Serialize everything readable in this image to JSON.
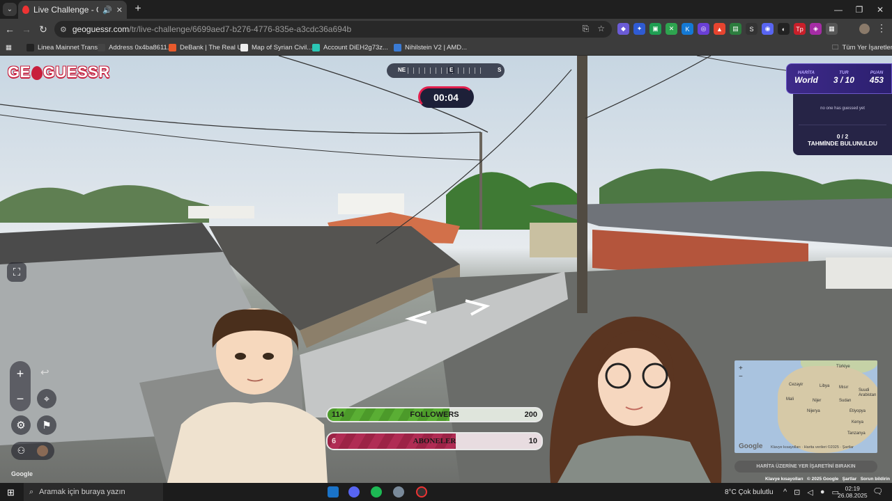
{
  "browser": {
    "tab_title": "Live Challenge - GeoGuessr",
    "url_host": "geoguessr.com",
    "url_path": "/tr/live-challenge/6699aed7-b276-4776-835e-a3cdc36a694b",
    "new_tab": "+",
    "bookmarks": [
      {
        "label": "Linea Mainnet Trans...",
        "color": "#222"
      },
      {
        "label": "Address 0x4ba8611...",
        "color": "#444"
      },
      {
        "label": "DeBank | The Real U...",
        "color": "#e85a2c"
      },
      {
        "label": "Map of Syrian Civil...",
        "color": "#eee"
      },
      {
        "label": "Account DiEH2g73z...",
        "color": "#2bc6b5"
      },
      {
        "label": "Nihilstein V2 | AMD...",
        "color": "#3a7bd5"
      }
    ],
    "all_bookmarks": "Tüm Yer İşaretleri",
    "extensions": [
      {
        "glyph": "◆",
        "color": "#6b5bd6"
      },
      {
        "glyph": "✦",
        "color": "#2f5bd3"
      },
      {
        "glyph": "▣",
        "color": "#1e9e52"
      },
      {
        "glyph": "✕",
        "color": "#2ea44f"
      },
      {
        "glyph": "K",
        "color": "#1479d4"
      },
      {
        "glyph": "◎",
        "color": "#6a3fd6"
      },
      {
        "glyph": "▲",
        "color": "#e7442f"
      },
      {
        "glyph": "▤",
        "color": "#2c7d3e"
      },
      {
        "glyph": "S",
        "color": "#333"
      },
      {
        "glyph": "◉",
        "color": "#5865f2"
      },
      {
        "glyph": "◐",
        "color": "#222"
      },
      {
        "glyph": "Tp",
        "color": "#c91f2a"
      },
      {
        "glyph": "◈",
        "color": "#a52ca5"
      },
      {
        "glyph": "▦",
        "color": "#555"
      }
    ]
  },
  "game": {
    "logo_left": "GE",
    "logo_right": "GUESSR",
    "compass": {
      "ne": "NE",
      "e": "E",
      "s": "S"
    },
    "timer": "00:04",
    "hud": {
      "map_label": "HARİTA",
      "map_value": "World",
      "round_label": "TUR",
      "round_value": "3 / 10",
      "score_label": "PUAN",
      "score_value": "453"
    },
    "no_guess": "no one has guessed yet",
    "guess_count": "0 / 2",
    "guess_label": "TAHMİNDE BULUNULDU",
    "followers": {
      "current": "114",
      "label": "FOLLOWERS",
      "goal": "200",
      "progress": 0.57
    },
    "subscribers": {
      "current": "6",
      "label": "ABONELER",
      "goal": "10",
      "progress": 0.6
    },
    "map_button": "HARİTA ÜZERİNE YER İŞARETİNİ BIRAKIN",
    "map_labels": [
      "Türkiye",
      "Cezayir",
      "Libya",
      "Mısır",
      "Mali",
      "Nijer",
      "Sudan",
      "Nijerya",
      "Etiyopya",
      "Kenya",
      "Tanzanya",
      "Suudi Arabistan"
    ],
    "google_mark": "Google",
    "attribution": [
      "Klavye kısayolları",
      "© 2025 Google",
      "Şartlar",
      "Sorun bildirin"
    ],
    "minimap_attribution": "Klavye kısayolları · Harita verileri ©2025 · Şartlar",
    "colors": {
      "accent_red": "#c81e3c",
      "followers_green": "#4c9a2a",
      "subs_red": "#9c2346",
      "hud_purple": "#3e2a8a"
    }
  },
  "taskbar": {
    "search_placeholder": "Aramak için buraya yazın",
    "weather": "8°C  Çok bulutlu",
    "time": "02:19",
    "date": "26.08.2025"
  }
}
